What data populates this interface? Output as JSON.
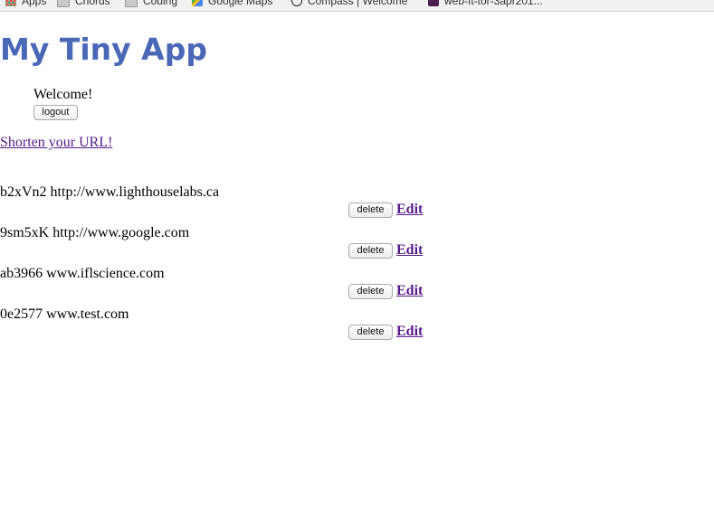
{
  "bookmarks": [
    {
      "label": "Apps",
      "icon": "apps-grid-icon"
    },
    {
      "label": "Chords",
      "icon": "folder-icon"
    },
    {
      "label": "Coding",
      "icon": "folder-icon"
    },
    {
      "label": "Google Maps",
      "icon": "google-maps-icon"
    },
    {
      "label": "Compass | Welcome",
      "icon": "compass-icon"
    },
    {
      "label": "web-ft-tor-3apr201...",
      "icon": "slack-icon"
    }
  ],
  "header": {
    "title": "My Tiny App",
    "title_color": "#4b67b7",
    "welcome": "Welcome!",
    "logout_label": "logout"
  },
  "shorten_link": "Shorten your URL!",
  "link_color": "#551a8b",
  "urls": [
    {
      "short": "b2xVn2",
      "long": "http://www.lighthouselabs.ca",
      "text": "b2xVn2 http://www.lighthouselabs.ca",
      "delete_label": "delete",
      "edit_label": "Edit"
    },
    {
      "short": "9sm5xK",
      "long": "http://www.google.com",
      "text": "9sm5xK http://www.google.com",
      "delete_label": "delete",
      "edit_label": "Edit"
    },
    {
      "short": "ab3966",
      "long": "www.iflscience.com",
      "text": "ab3966 www.iflscience.com",
      "delete_label": "delete",
      "edit_label": "Edit"
    },
    {
      "short": "0e2577",
      "long": "www.test.com",
      "text": "0e2577 www.test.com",
      "delete_label": "delete",
      "edit_label": "Edit"
    }
  ]
}
